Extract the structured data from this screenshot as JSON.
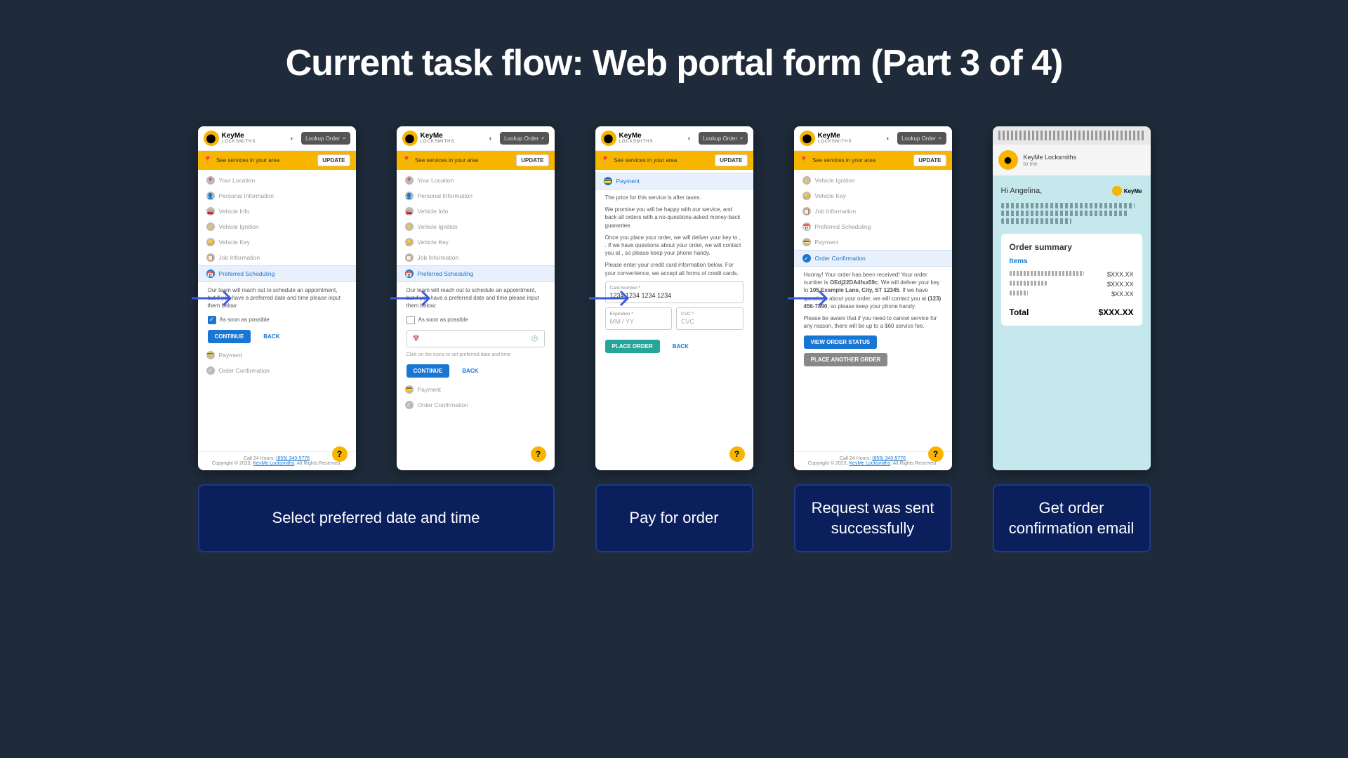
{
  "title": "Current task flow: Web portal form (Part 3 of 4)",
  "brand": {
    "name": "KeyMe",
    "sub": "LOCKSMITHS"
  },
  "lookup": "Lookup Order",
  "banner": {
    "text": "See services in your area",
    "btn": "UPDATE"
  },
  "steps": {
    "location": "Your Location",
    "personal": "Personal Information",
    "vehicle": "Vehicle Info",
    "ignition": "Vehicle Ignition",
    "key": "Vehicle Key",
    "job": "Job Information",
    "scheduling": "Preferred Scheduling",
    "payment": "Payment",
    "confirmation": "Order Confirmation"
  },
  "scheduling": {
    "intro": "Our team will reach out to schedule an appointment, but if you have a preferred date and time please input them below:",
    "asap": "As soon as possible",
    "hint": "Click on the icons to set preferred date and time",
    "continue": "CONTINUE",
    "back": "BACK"
  },
  "payment": {
    "p1": "The price for this service is after taxes.",
    "p2": "We promise you will be happy with our service, and back all orders with a no-questions-asked money-back guarantee.",
    "p3": "Once you place your order, we will deliver your key to , . If we have questions about your order, we will contact you at , so please keep your phone handy.",
    "p4": "Please enter your credit card information below. For your convenience, we accept all forms of credit cards.",
    "card_label": "Card Number *",
    "card_ph": "1234 1234 1234 1234",
    "exp_label": "Expiration *",
    "exp_ph": "MM / YY",
    "cvc_label": "CVC *",
    "cvc_ph": "CVC",
    "place": "PLACE ORDER",
    "back": "BACK"
  },
  "confirm": {
    "p1a": "Hooray! Your order has been received! Your order number is ",
    "order_no": "OEdj22DA4fsa59c",
    "p1b": ". We will deliver your key to ",
    "addr": "105 Example Lane, City, ST 12345",
    "p1c": ". If we have questions about your order, we will contact you at ",
    "phone": "(123) 456-7890",
    "p1d": ", so please keep your phone handy.",
    "p2": "Please be aware that if you need to cancel service for any reason, there will be up to a $60 service fee.",
    "view": "VIEW ORDER STATUS",
    "another": "PLACE ANOTHER ORDER"
  },
  "footer": {
    "call": "Call 24 Hours: ",
    "phone": "(855) 343-5776",
    "copy": "Copyright © 2023, ",
    "link": "KeyMe Locksmiths",
    "rights": ". All Rights Reserved."
  },
  "email": {
    "from": "KeyMe Locksmiths",
    "to": "to me",
    "greeting": "Hi Angelina,",
    "summary": "Order summary",
    "items": "Items",
    "price": "$XXX.XX",
    "small": "$XX.XX",
    "total_label": "Total",
    "total": "$XXX.XX"
  },
  "captions": {
    "c1": "Select preferred date and time",
    "c2": "Pay for order",
    "c3": "Request was sent successfully",
    "c4": "Get order confirmation email"
  }
}
